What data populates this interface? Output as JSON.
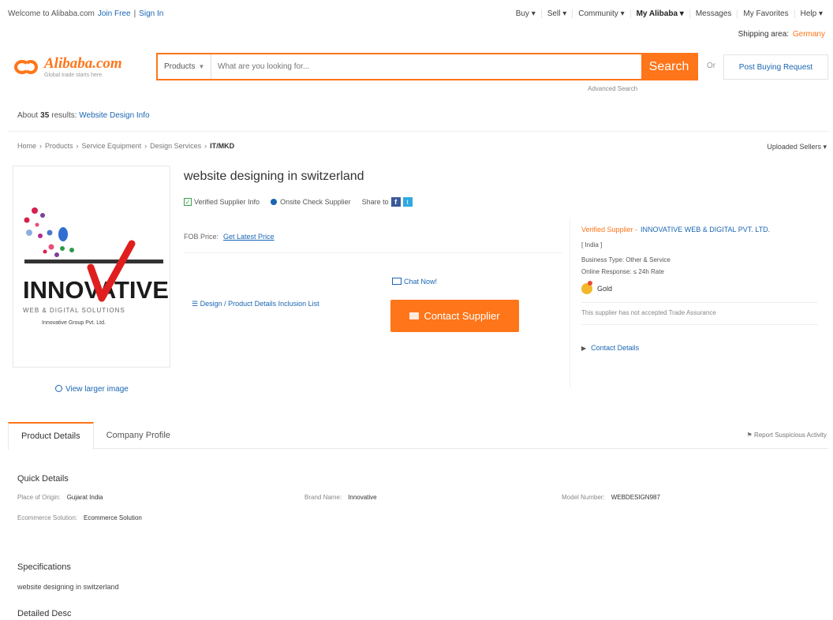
{
  "topbar": {
    "welcome": "Welcome to Alibaba.com",
    "join": "Join Free",
    "signin": "Sign In",
    "menu": [
      "Buy ▾",
      "Sell ▾",
      "Community ▾",
      "My Alibaba ▾",
      "Messages",
      "My Favorites",
      "Help ▾"
    ]
  },
  "shipping": {
    "label": "Shipping area:",
    "value": "Germany"
  },
  "logo": {
    "word": "Alibaba.com",
    "tagline": "Global trade starts here."
  },
  "search": {
    "category": "Products",
    "placeholder": "What are you looking for...",
    "button": "Search",
    "advanced": "Advanced Search",
    "or": "Or",
    "post_request": "Post Buying Request"
  },
  "results": {
    "prefix": "About",
    "count": "35",
    "suffix": "results:",
    "link": "Website Design Info"
  },
  "breadcrumb": [
    "Home",
    "Products",
    "Service Equipment",
    "Design Services",
    "IT/MKD"
  ],
  "uploaded_by": "Uploaded Sellers",
  "product": {
    "title": "website designing in switzerland",
    "badges": {
      "verified": "Verified Supplier Info",
      "onsite": "Onsite Check Supplier",
      "share": "Share to"
    },
    "fob": "FOB Price:",
    "latest_price": "Get Latest Price",
    "design_link": "Design / Product Details Inclusion List",
    "chat": "Chat Now!",
    "contact": "Contact Supplier",
    "view_larger": "View larger image"
  },
  "supplier": {
    "label": "Verified Supplier -",
    "name": "INNOVATIVE WEB & DIGITAL PVT. LTD.",
    "country": "[ India ]",
    "business_type": "Business Type: Other & Service",
    "response": "Online Response: ≤ 24h Rate",
    "gold": "Gold",
    "note": "This supplier has not accepted Trade Assurance",
    "details": "Contact Details"
  },
  "tabs": [
    {
      "label": "Product Details",
      "active": true
    },
    {
      "label": "Company Profile",
      "active": false
    }
  ],
  "report": "Report Suspicious Activity",
  "quick": {
    "heading": "Quick Details",
    "fields": [
      {
        "label": "Place of Origin:",
        "value": "Gujarat India"
      },
      {
        "label": "Brand Name:",
        "value": "Innovative"
      },
      {
        "label": "Model Number:",
        "value": "WEBDESIGN987"
      },
      {
        "label": "Ecommerce Solution:",
        "value": "Ecommerce Solution"
      }
    ]
  },
  "specs": {
    "heading": "Specifications",
    "text": "website designing in switzerland"
  },
  "detailed_desc": "Detailed Desc",
  "innovative": {
    "big": "INNOVATIVE",
    "sub1": "WEB & DIGITAL SOLUTIONS",
    "sub2": "Innovative Group Pvt. Ltd.",
    "bar": "web & digital"
  },
  "colors": {
    "accent": "#ff7519",
    "link": "#1a66b3"
  }
}
